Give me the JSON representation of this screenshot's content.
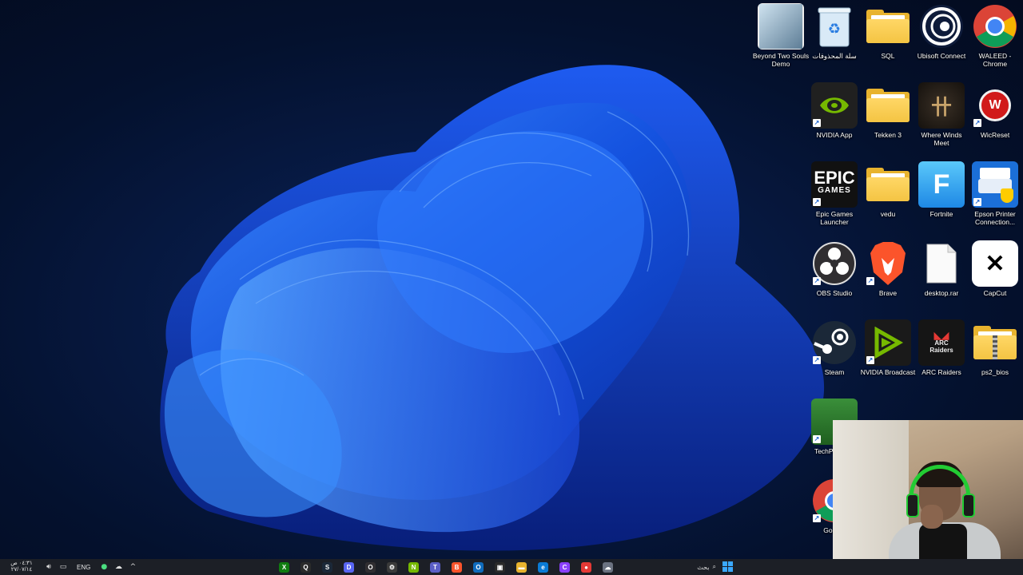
{
  "desktop": {
    "icons": [
      {
        "label": "Beyond Two Souls Demo",
        "icon": "game-thumbnail-icon"
      },
      {
        "label": "سلة المحذوفات",
        "icon": "recycle-bin-icon"
      },
      {
        "label": "SQL",
        "icon": "folder-icon"
      },
      {
        "label": "Ubisoft Connect",
        "icon": "ubisoft-icon"
      },
      {
        "label": "WALEED - Chrome",
        "icon": "chrome-icon"
      },
      {
        "label": "NVIDIA App",
        "icon": "nvidia-icon"
      },
      {
        "label": "Tekken 3",
        "icon": "folder-icon"
      },
      {
        "label": "Where Winds Meet",
        "icon": "where-winds-meet-icon"
      },
      {
        "label": "WicReset",
        "icon": "wicreset-icon"
      },
      {
        "label": "Epic Games Launcher",
        "icon": "epic-games-icon",
        "art": "EPIC\nGAMES"
      },
      {
        "label": "vedu",
        "icon": "folder-icon"
      },
      {
        "label": "Fortnite",
        "icon": "fortnite-icon",
        "art": "F"
      },
      {
        "label": "Epson Printer Connection...",
        "icon": "epson-printer-icon"
      },
      {
        "label": "OBS Studio",
        "icon": "obs-icon"
      },
      {
        "label": "Brave",
        "icon": "brave-icon"
      },
      {
        "label": "desktop.rar",
        "icon": "file-icon"
      },
      {
        "label": "CapCut",
        "icon": "capcut-icon"
      },
      {
        "label": "Steam",
        "icon": "steam-icon"
      },
      {
        "label": "NVIDIA Broadcast",
        "icon": "nvidia-broadcast-icon"
      },
      {
        "label": "ARC Raiders",
        "icon": "arc-raiders-icon"
      },
      {
        "label": "ps2_bios",
        "icon": "zip-folder-icon"
      },
      {
        "label": "TechPo... GP",
        "icon": "techpowerup-gpuz-icon"
      },
      {
        "label": "Google",
        "icon": "chrome-icon"
      }
    ]
  },
  "webcam": {
    "label": "webcam-overlay"
  },
  "taskbar": {
    "clock_time": "٠٤:٣١ ص",
    "clock_date": "٢٧/٠٧/١٤",
    "language": "ENG",
    "search_label": "بحث",
    "apps": [
      {
        "name": "xbox",
        "glyph": "X",
        "color": "#107c10"
      },
      {
        "name": "search-app",
        "glyph": "Q",
        "color": "#2b2b2b"
      },
      {
        "name": "steam",
        "glyph": "S",
        "color": "#1b2838"
      },
      {
        "name": "discord",
        "glyph": "D",
        "color": "#5865f2"
      },
      {
        "name": "obs",
        "glyph": "O",
        "color": "#302e31"
      },
      {
        "name": "settings",
        "glyph": "⚙",
        "color": "#3a3a3a"
      },
      {
        "name": "nvidia",
        "glyph": "N",
        "color": "#76b900"
      },
      {
        "name": "teams",
        "glyph": "T",
        "color": "#5b5fc7"
      },
      {
        "name": "brave",
        "glyph": "B",
        "color": "#fb542b"
      },
      {
        "name": "outlook",
        "glyph": "O",
        "color": "#0f6cbd"
      },
      {
        "name": "store",
        "glyph": "▣",
        "color": "#2a2a2a"
      },
      {
        "name": "file-explorer",
        "glyph": "▬",
        "color": "#e8b32e"
      },
      {
        "name": "edge",
        "glyph": "e",
        "color": "#0a7bd6"
      },
      {
        "name": "copilot",
        "glyph": "C",
        "color": "#8a3ffc"
      },
      {
        "name": "chrome",
        "glyph": "●",
        "color": "#e53935"
      },
      {
        "name": "weather",
        "glyph": "☁",
        "color": "#6b7280"
      }
    ]
  }
}
